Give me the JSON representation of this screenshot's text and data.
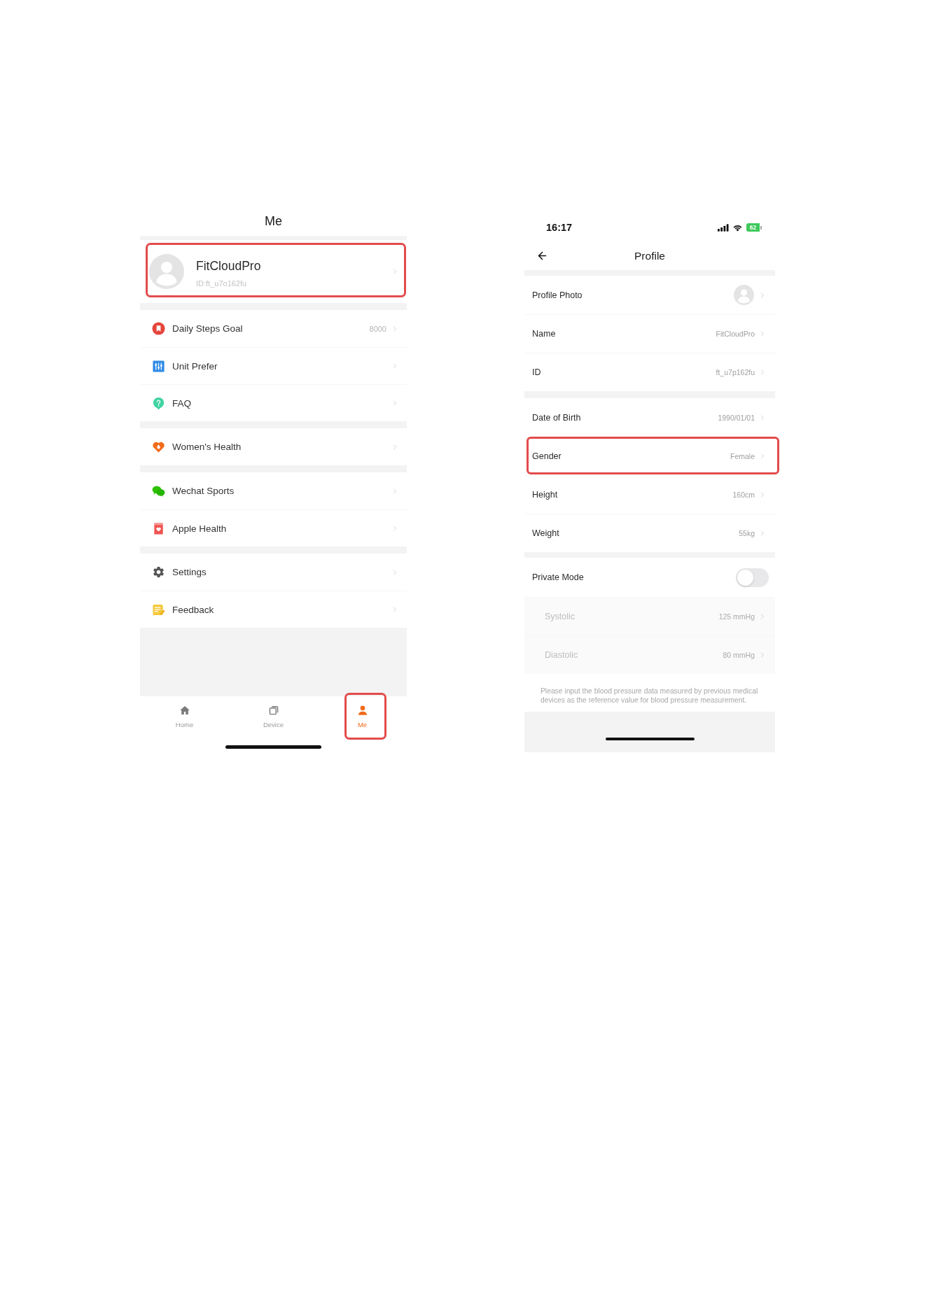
{
  "me_page": {
    "title": "Me",
    "profile": {
      "name": "FitCloudPro",
      "id": "ID:ft_u7o162fu",
      "highlighted": true
    },
    "menu_groups": [
      {
        "items": [
          {
            "label": "Daily Steps Goal",
            "value": "8000"
          },
          {
            "label": "Unit Prefer"
          },
          {
            "label": "FAQ"
          }
        ]
      },
      {
        "items": [
          {
            "label": "Women's Health"
          }
        ]
      },
      {
        "items": [
          {
            "label": "Wechat Sports"
          },
          {
            "label": "Apple Health"
          }
        ]
      },
      {
        "items": [
          {
            "label": "Settings"
          },
          {
            "label": "Feedback"
          }
        ]
      }
    ],
    "tabs": [
      {
        "label": "Home",
        "selected": false,
        "highlighted": false
      },
      {
        "label": "Device",
        "selected": false,
        "highlighted": false
      },
      {
        "label": "Me",
        "selected": true,
        "highlighted": true
      }
    ]
  },
  "profile_page": {
    "status_bar": {
      "time": "16:17",
      "battery": "62"
    },
    "title": "Profile",
    "groups": [
      {
        "rows": [
          {
            "kind": "photo",
            "label": "Profile Photo",
            "highlighted": false
          },
          {
            "kind": "value",
            "label": "Name",
            "value": "FitCloudPro",
            "highlighted": false
          },
          {
            "kind": "value",
            "label": "ID",
            "value": "ft_u7p162fu",
            "highlighted": false
          }
        ]
      },
      {
        "rows": [
          {
            "kind": "value",
            "label": "Date of Birth",
            "value": "1990/01/01",
            "highlighted": false
          },
          {
            "kind": "value",
            "label": "Gender",
            "value": "Female",
            "highlighted": true
          },
          {
            "kind": "value",
            "label": "Height",
            "value": "160cm",
            "highlighted": false
          },
          {
            "kind": "value",
            "label": "Weight",
            "value": "55kg",
            "highlighted": false
          }
        ]
      },
      {
        "rows": [
          {
            "kind": "toggle",
            "label": "Private Mode",
            "on": false,
            "highlighted": false,
            "children": [
              {
                "label": "Systolic",
                "value": "125 mmHg",
                "disabled": true
              },
              {
                "label": "Diastolic",
                "value": "80 mmHg",
                "disabled": true
              }
            ]
          }
        ]
      }
    ],
    "note": "Please input the blood pressure data measured by previous medical devices as the reference value for blood pressure measurement."
  }
}
